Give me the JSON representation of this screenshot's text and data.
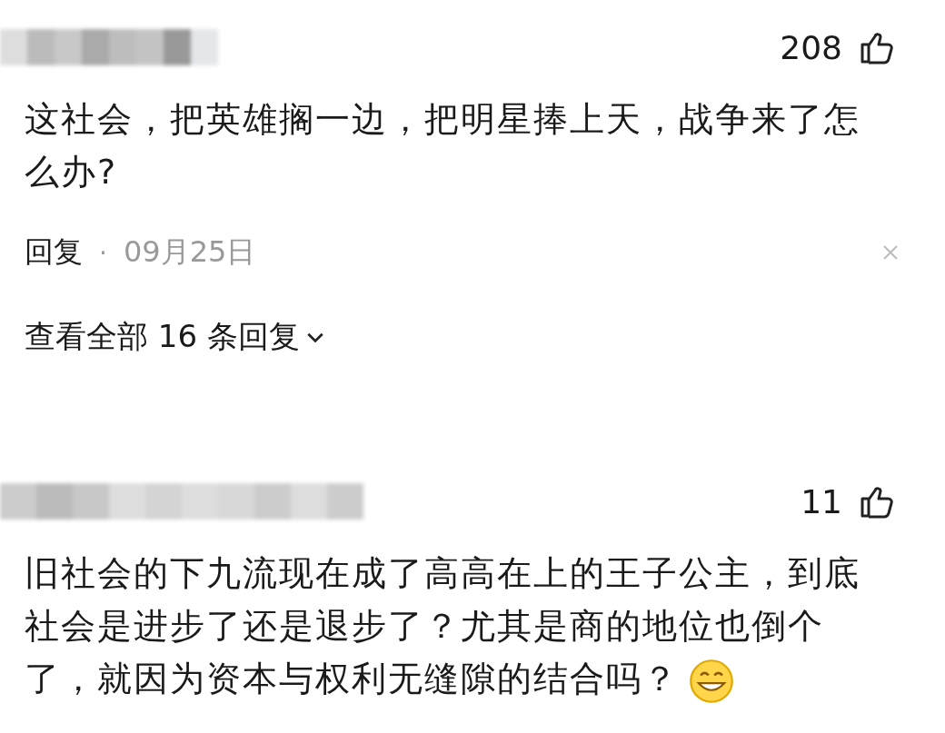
{
  "comments": [
    {
      "likes": "208",
      "text": "这社会，把英雄搁一边，把明星捧上天，战争来了怎么办?",
      "reply_label": "回复",
      "separator": "·",
      "date": "09月25日",
      "view_replies": "查看全部 16 条回复",
      "emoji": false
    },
    {
      "likes": "11",
      "text": "旧社会的下九流现在成了高高在上的王子公主，到底社会是进步了还是退步了？尤其是商的地位也倒个了，就因为资本与权利无缝隙的结合吗？",
      "emoji": true
    }
  ]
}
